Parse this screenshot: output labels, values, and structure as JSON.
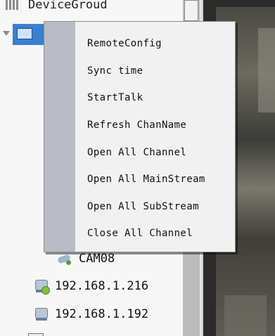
{
  "tree": {
    "header_label": "DeviceGroud",
    "rows": [
      {
        "label": "CAM08"
      },
      {
        "label": "192.168.1.216"
      },
      {
        "label": "192.168.1.192"
      }
    ]
  },
  "context_menu": {
    "items": [
      {
        "label": "RemoteConfig"
      },
      {
        "label": "Sync time"
      },
      {
        "label": "StartTalk"
      },
      {
        "label": "Refresh ChanName"
      },
      {
        "label": "Open All Channel"
      },
      {
        "label": "Open All MainStream"
      },
      {
        "label": "Open All SubStream"
      },
      {
        "label": "Close All Channel"
      }
    ]
  },
  "icons": {
    "header": "grid-icon",
    "device": "dvr-device-icon",
    "camera": "camera-icon",
    "ip_online": "ip-device-online-icon",
    "ip_offline": "ip-device-icon"
  },
  "colors": {
    "selection": "#3a7fd0",
    "menu_gutter": "#b9bcc4",
    "menu_bg": "#f1f1f1",
    "online_status": "#7cc242"
  }
}
